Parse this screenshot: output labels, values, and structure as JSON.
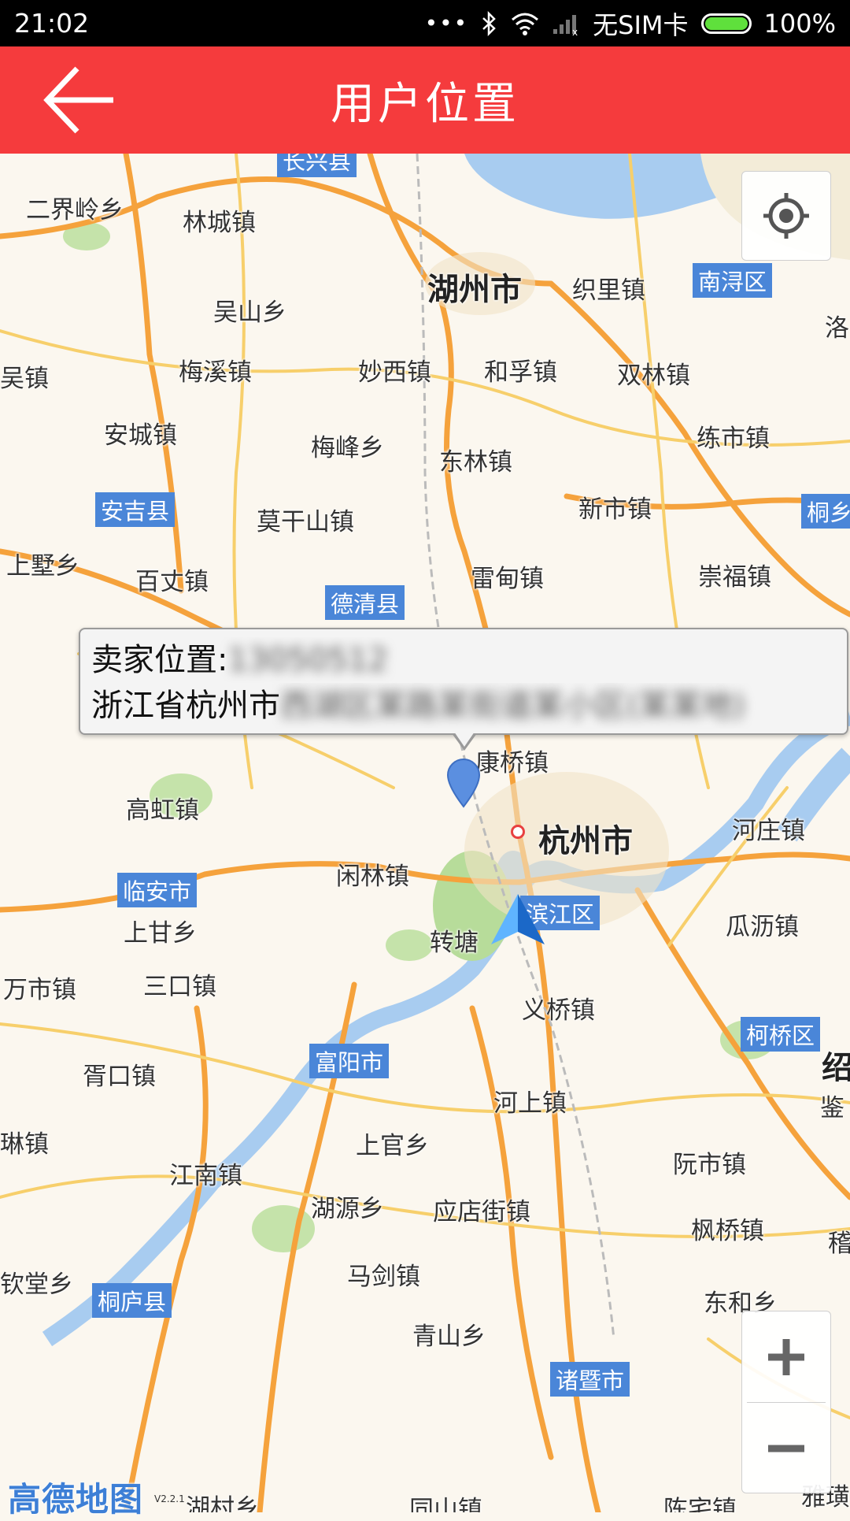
{
  "status": {
    "time": "21:02",
    "carrier": "无SIM卡",
    "battery": "100%"
  },
  "header": {
    "title": "用户位置"
  },
  "popup": {
    "seller_label": "卖家位置:",
    "seller_phone": "13050512",
    "address_prefix": "浙江省杭州市",
    "address_rest": "西湖区某路某街道某小区(某某地)"
  },
  "map": {
    "city_labels": [
      {
        "text": "湖州市"
      },
      {
        "text": "杭州市"
      }
    ],
    "county_tags": [
      {
        "text": "长兴县"
      },
      {
        "text": "南浔区"
      },
      {
        "text": "安吉县"
      },
      {
        "text": "德清县"
      },
      {
        "text": "桐乡"
      },
      {
        "text": "临安市"
      },
      {
        "text": "滨江区"
      },
      {
        "text": "富阳市"
      },
      {
        "text": "柯桥区"
      },
      {
        "text": "桐庐县"
      },
      {
        "text": "诸暨市"
      }
    ],
    "place_labels": [
      {
        "text": "二界岭乡"
      },
      {
        "text": "林城镇"
      },
      {
        "text": "织里镇"
      },
      {
        "text": "洛"
      },
      {
        "text": "吴山乡"
      },
      {
        "text": "吴镇"
      },
      {
        "text": "梅溪镇"
      },
      {
        "text": "妙西镇"
      },
      {
        "text": "和孚镇"
      },
      {
        "text": "双林镇"
      },
      {
        "text": "安城镇"
      },
      {
        "text": "梅峰乡"
      },
      {
        "text": "东林镇"
      },
      {
        "text": "练市镇"
      },
      {
        "text": "新市镇"
      },
      {
        "text": "莫干山镇"
      },
      {
        "text": "上墅乡"
      },
      {
        "text": "百丈镇"
      },
      {
        "text": "雷甸镇"
      },
      {
        "text": "崇福镇"
      },
      {
        "text": "康桥镇"
      },
      {
        "text": "高虹镇"
      },
      {
        "text": "河庄镇"
      },
      {
        "text": "闲林镇"
      },
      {
        "text": "上甘乡"
      },
      {
        "text": "转塘"
      },
      {
        "text": "瓜沥镇"
      },
      {
        "text": "万市镇"
      },
      {
        "text": "三口镇"
      },
      {
        "text": "义桥镇"
      },
      {
        "text": "胥口镇"
      },
      {
        "text": "绍"
      },
      {
        "text": "河上镇"
      },
      {
        "text": "琳镇"
      },
      {
        "text": "上官乡"
      },
      {
        "text": "鉴"
      },
      {
        "text": "江南镇"
      },
      {
        "text": "阮市镇"
      },
      {
        "text": "湖源乡"
      },
      {
        "text": "应店街镇"
      },
      {
        "text": "枫桥镇"
      },
      {
        "text": "稽"
      },
      {
        "text": "钦堂乡"
      },
      {
        "text": "马剑镇"
      },
      {
        "text": "东和乡"
      },
      {
        "text": "青山乡"
      },
      {
        "text": "湖村乡"
      },
      {
        "text": "同山镇"
      },
      {
        "text": "陈宅镇"
      },
      {
        "text": "雅璜"
      }
    ]
  },
  "logo": {
    "text": "高德地图",
    "version": "V2.2.1"
  },
  "colors": {
    "header": "#f53b3d",
    "road": "#f5a23c",
    "water": "#a8ccf0",
    "county_tag": "#4a86d8"
  }
}
